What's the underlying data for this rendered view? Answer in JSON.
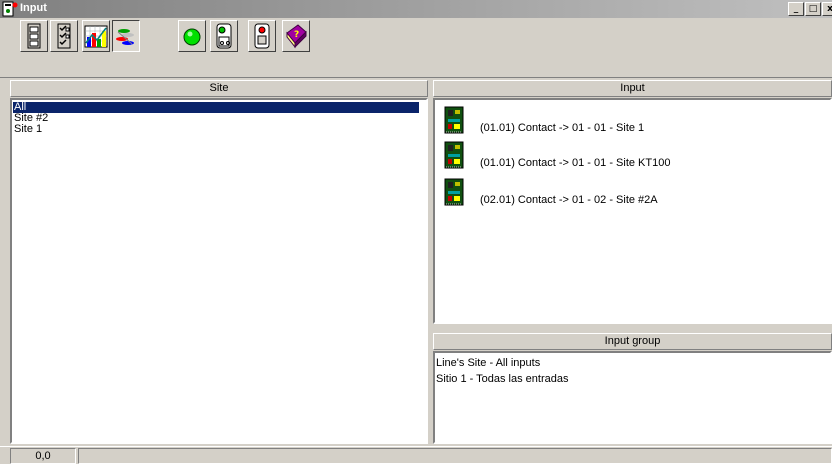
{
  "window": {
    "title": "Input"
  },
  "titlebar_buttons": {
    "minimize": "_",
    "maximize": "□",
    "close": "x"
  },
  "toolbar": {
    "buttons": [
      {
        "name": "devices-view",
        "icon": "cabinet-icon"
      },
      {
        "name": "checklist-view",
        "icon": "checklist-icon"
      },
      {
        "name": "chart-view",
        "icon": "chart-icon"
      },
      {
        "name": "network-view",
        "icon": "network-icon",
        "pressed": true
      },
      {
        "name": "status-on",
        "icon": "green-circle-icon"
      },
      {
        "name": "input-view",
        "icon": "input-device-icon"
      },
      {
        "name": "output-view",
        "icon": "output-device-icon"
      },
      {
        "name": "help",
        "icon": "help-book-icon"
      }
    ]
  },
  "site_panel": {
    "header": "Site",
    "items": [
      {
        "label": "All",
        "selected": true
      },
      {
        "label": "Site #2"
      },
      {
        "label": "Site 1"
      }
    ]
  },
  "input_panel": {
    "header": "Input",
    "items": [
      {
        "label": "(01.01) Contact -> 01 - 01 - Site 1",
        "icon": "circuit-board-icon"
      },
      {
        "label": "(01.01) Contact -> 01 - 01 - Site KT100",
        "icon": "circuit-board-icon"
      },
      {
        "label": "(02.01) Contact -> 01 - 02 - Site #2A",
        "icon": "circuit-board-icon"
      }
    ]
  },
  "input_group_panel": {
    "header": "Input group",
    "items": [
      {
        "label": "Line's Site - All inputs"
      },
      {
        "label": "Sitio 1 - Todas las entradas"
      }
    ]
  },
  "statusbar": {
    "coords": "0,0",
    "message": ""
  },
  "colors": {
    "selection": "#0a246a",
    "face": "#d4d0c8",
    "title_gradient_start": "#808080"
  }
}
